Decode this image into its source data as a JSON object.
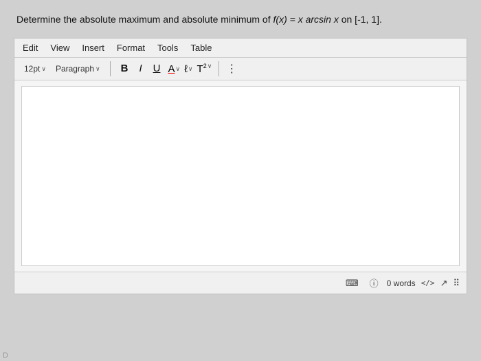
{
  "question": {
    "text_before": "Determine the absolute maximum and absolute minimum of ",
    "math_expr": "f(x) = x arcsin x",
    "text_after": " on [-1, 1]."
  },
  "menu": {
    "items": [
      "Edit",
      "View",
      "Insert",
      "Format",
      "Tools",
      "Table"
    ]
  },
  "toolbar": {
    "font_size": "12pt",
    "font_size_chevron": "∨",
    "paragraph": "Paragraph",
    "paragraph_chevron": "∨",
    "bold_label": "B",
    "italic_label": "I",
    "underline_label": "U",
    "font_color_label": "A",
    "highlight_label": "ℓ",
    "superscript_label": "T",
    "superscript_num": "2",
    "more_label": "⋮"
  },
  "status_bar": {
    "word_count_label": "0 words",
    "code_label": "</>",
    "d_label": "D"
  }
}
